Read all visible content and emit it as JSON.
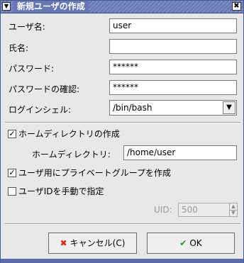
{
  "window": {
    "title": "新規ユーザの作成",
    "menu_icon": "▼",
    "close_icon": "✖"
  },
  "form": {
    "username_label": "ユーザ名:",
    "username_value": "user",
    "fullname_label": "氏名:",
    "fullname_value": "",
    "password_label": "パスワード:",
    "password_value": "******",
    "confirm_label": "パスワードの確認:",
    "confirm_value": "******",
    "shell_label": "ログインシェル:",
    "shell_value": "/bin/bash",
    "shell_arrow": "▼"
  },
  "home": {
    "create_label": "ホームディレクトリの作成",
    "create_checked": true,
    "dir_label": "ホームディレクトリ:",
    "dir_value": "/home/user"
  },
  "private_group": {
    "label": "ユーザ用にプライベートグループを作成",
    "checked": true
  },
  "manual_uid": {
    "label": "ユーザIDを手動で指定",
    "checked": false,
    "uid_label": "UID:",
    "uid_value": "500"
  },
  "buttons": {
    "cancel_label": "キャンセル(C)",
    "cancel_icon": "✖",
    "ok_label": "OK",
    "ok_icon": "✔"
  },
  "colors": {
    "titlebar": "#6677b5",
    "cancel_icon": "#d62b1f",
    "ok_icon": "#2c8c2c"
  }
}
